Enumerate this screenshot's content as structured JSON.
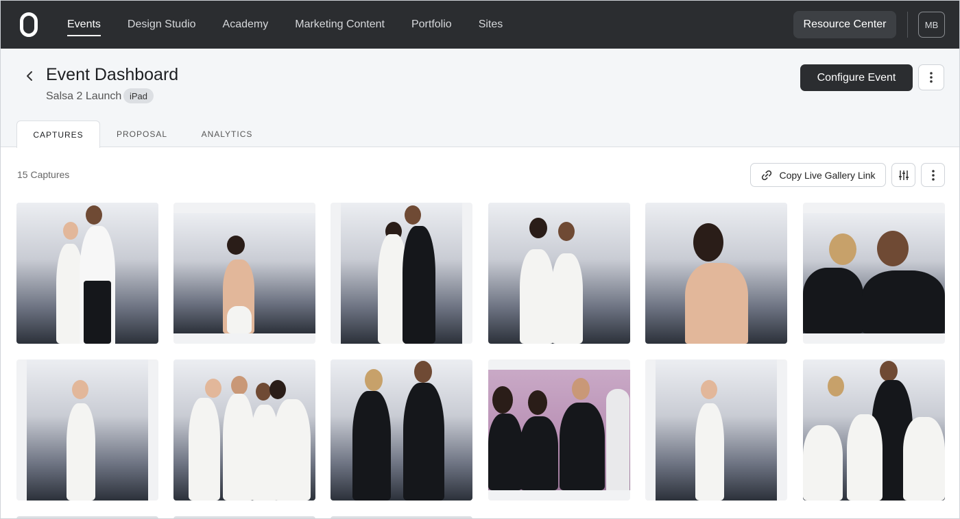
{
  "nav": {
    "links": [
      "Events",
      "Design Studio",
      "Academy",
      "Marketing Content",
      "Portfolio",
      "Sites"
    ],
    "active": "Events",
    "resource_center": "Resource Center",
    "avatar_initials": "MB"
  },
  "header": {
    "title": "Event Dashboard",
    "event_name": "Salsa 2 Launch",
    "device_badge": "iPad",
    "configure_label": "Configure Event"
  },
  "tabs": [
    "CAPTURES",
    "PROPOSAL",
    "ANALYTICS"
  ],
  "active_tab": "CAPTURES",
  "captures": {
    "count_label": "15 Captures",
    "copy_link_label": "Copy Live Gallery Link"
  },
  "colors": {
    "nav_bg": "#2b2d30",
    "header_bg": "#f4f6f8",
    "primary_button": "#2b2d30"
  },
  "icons": {
    "logo": "brand-logo-icon",
    "back": "chevron-left-icon",
    "more": "vertical-dots-icon",
    "link": "link-icon",
    "filter": "sliders-icon"
  }
}
